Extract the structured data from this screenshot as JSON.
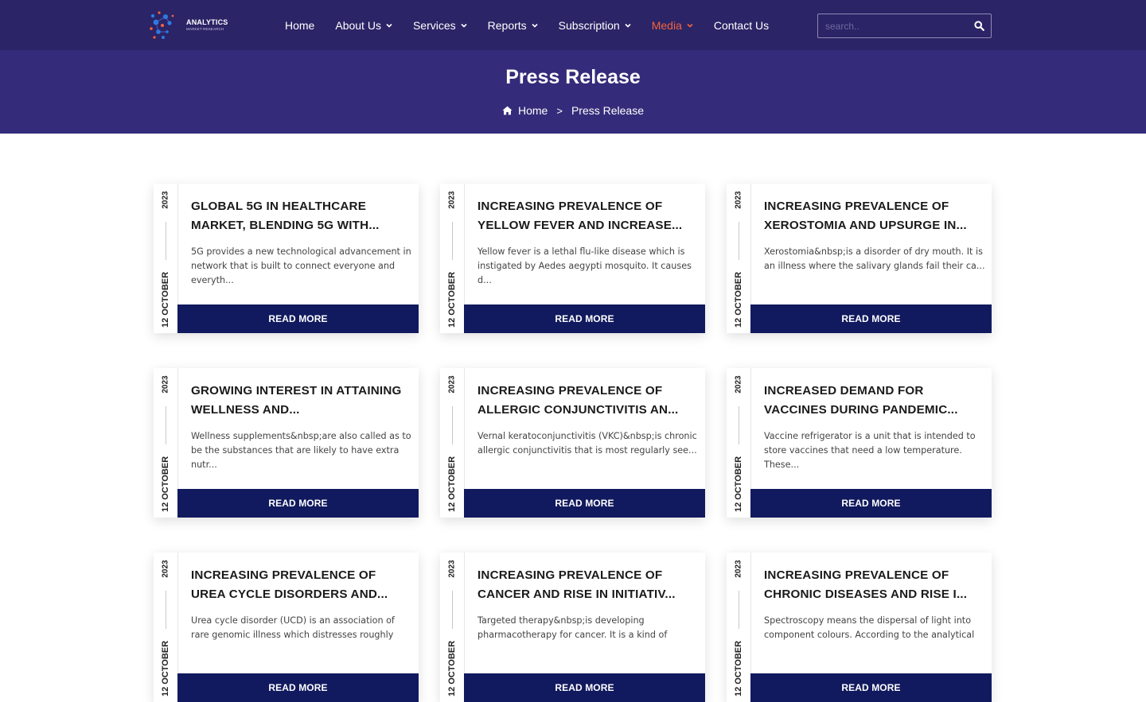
{
  "brand": {
    "name": "ANALYTICS",
    "tagline": "MARKET RESEARCH"
  },
  "nav": [
    {
      "label": "Home",
      "dropdown": false,
      "active": false
    },
    {
      "label": "About Us",
      "dropdown": true,
      "active": false
    },
    {
      "label": "Services",
      "dropdown": true,
      "active": false
    },
    {
      "label": "Reports",
      "dropdown": true,
      "active": false
    },
    {
      "label": "Subscription",
      "dropdown": true,
      "active": false
    },
    {
      "label": "Media",
      "dropdown": true,
      "active": true
    },
    {
      "label": "Contact Us",
      "dropdown": false,
      "active": false
    }
  ],
  "search": {
    "placeholder": "search..",
    "icon": "search-icon"
  },
  "hero": {
    "title": "Press Release"
  },
  "breadcrumb": {
    "home": "Home",
    "separator": ">",
    "current": "Press Release"
  },
  "colors": {
    "nav_bg": "#2b2466",
    "hero_bg": "#342c7a",
    "accent": "#f2633f",
    "button_bg": "#111a5e"
  },
  "cards": [
    {
      "year": "2023",
      "date": "12 OCTOBER",
      "title": "GLOBAL 5G IN HEALTHCARE MARKET, BLENDING 5G WITH...",
      "desc": "5G provides a new technological advancement in network that is built to connect everyone and everyth...",
      "cta": "READ MORE"
    },
    {
      "year": "2023",
      "date": "12 OCTOBER",
      "title": "INCREASING PREVALENCE OF YELLOW FEVER AND INCREASE...",
      "desc": "Yellow fever is a lethal flu-like disease which is instigated by Aedes aegypti mosquito. It causes d...",
      "cta": "READ MORE"
    },
    {
      "year": "2023",
      "date": "12 OCTOBER",
      "title": "INCREASING PREVALENCE OF XEROSTOMIA AND UPSURGE IN...",
      "desc": "Xerostomia&nbsp;is a disorder of dry mouth. It is an illness where the salivary glands fail their ca...",
      "cta": "READ MORE"
    },
    {
      "year": "2023",
      "date": "12 OCTOBER",
      "title": "GROWING INTEREST IN ATTAINING WELLNESS AND...",
      "desc": "Wellness supplements&nbsp;are also called as to be the substances that are likely to have extra nutr...",
      "cta": "READ MORE"
    },
    {
      "year": "2023",
      "date": "12 OCTOBER",
      "title": "INCREASING PREVALENCE OF ALLERGIC CONJUNCTIVITIS AN...",
      "desc": "Vernal keratoconjunctivitis (VKC)&nbsp;is chronic allergic conjunctivitis that is most regularly see...",
      "cta": "READ MORE"
    },
    {
      "year": "2023",
      "date": "12 OCTOBER",
      "title": "INCREASED DEMAND FOR VACCINES DURING PANDEMIC...",
      "desc": "Vaccine refrigerator is a unit that is intended to store vaccines that need a low temperature. These...",
      "cta": "READ MORE"
    },
    {
      "year": "2023",
      "date": "12 OCTOBER",
      "title": "INCREASING PREVALENCE OF UREA CYCLE DISORDERS AND...",
      "desc": "Urea cycle disorder (UCD) is an association of rare genomic illness which distresses roughly",
      "cta": "READ MORE"
    },
    {
      "year": "2023",
      "date": "12 OCTOBER",
      "title": "INCREASING PREVALENCE OF CANCER AND RISE IN INITIATIV...",
      "desc": "Targeted therapy&nbsp;is developing pharmacotherapy for cancer. It is a kind of",
      "cta": "READ MORE"
    },
    {
      "year": "2023",
      "date": "12 OCTOBER",
      "title": "INCREASING PREVALENCE OF CHRONIC DISEASES AND RISE I...",
      "desc": "Spectroscopy means the dispersal of light into component colours. According to the analytical",
      "cta": "READ MORE"
    }
  ]
}
